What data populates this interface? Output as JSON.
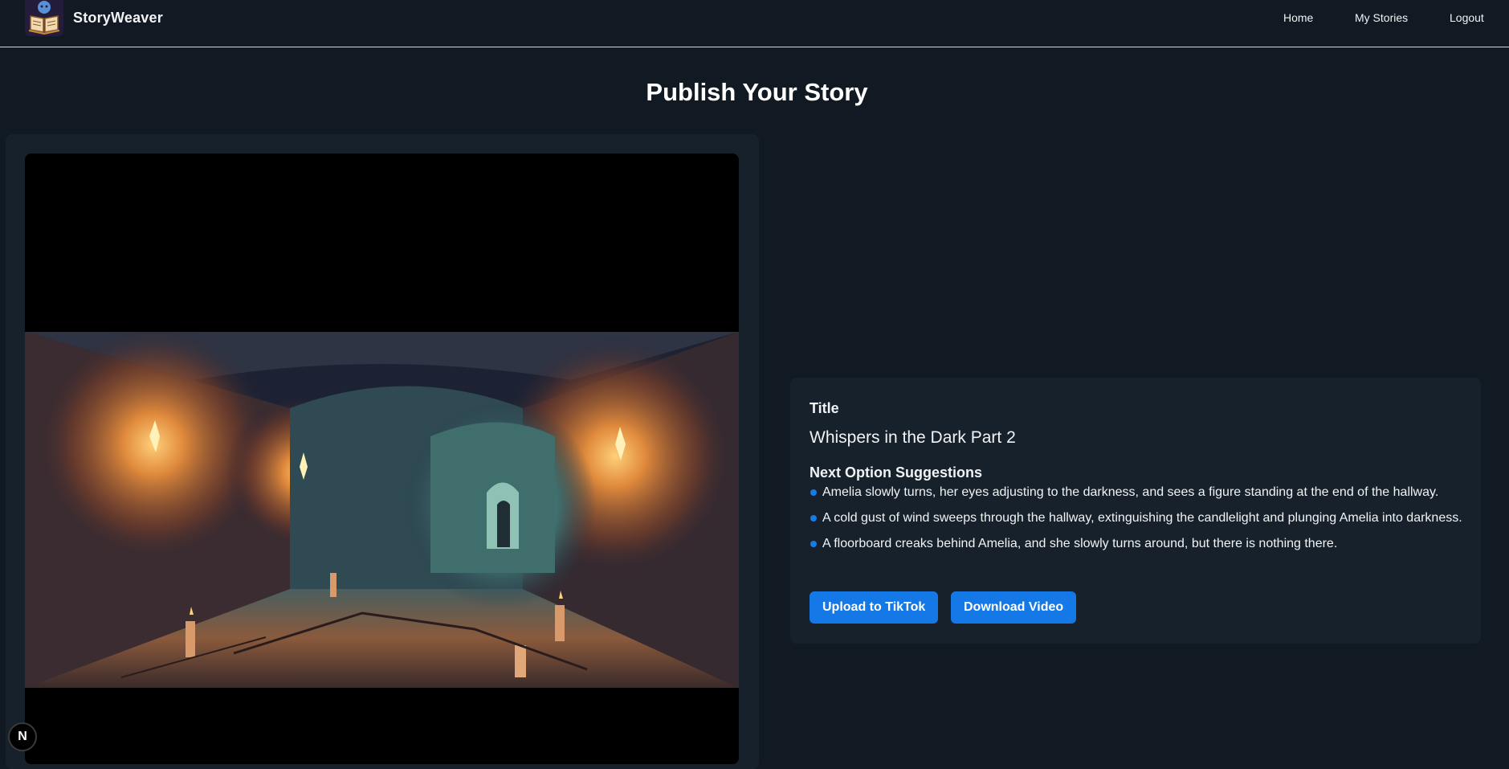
{
  "navbar": {
    "brand": "StoryWeaver",
    "links": [
      {
        "label": "Home"
      },
      {
        "label": "My Stories"
      },
      {
        "label": "Logout"
      }
    ]
  },
  "page": {
    "title": "Publish Your Story"
  },
  "details": {
    "title_label": "Title",
    "story_title": "Whispers in the Dark Part 2",
    "suggestions_label": "Next Option Suggestions",
    "suggestions": [
      "Amelia slowly turns, her eyes adjusting to the darkness, and sees a figure standing at the end of the hallway.",
      "A cold gust of wind sweeps through the hallway, extinguishing the candlelight and plunging Amelia into darkness.",
      "A floorboard creaks behind Amelia, and she slowly turns around, but there is nothing there."
    ],
    "buttons": {
      "upload": "Upload to TikTok",
      "download": "Download Video"
    }
  },
  "dev_badge": {
    "letter": "N"
  },
  "colors": {
    "background": "#111a22",
    "panel": "#17212b",
    "accent": "#1479e6",
    "text": "#ffffff"
  },
  "icons": {
    "logo": "open-book-icon",
    "bullet": "dot-icon",
    "badge": "n-letter-icon"
  }
}
